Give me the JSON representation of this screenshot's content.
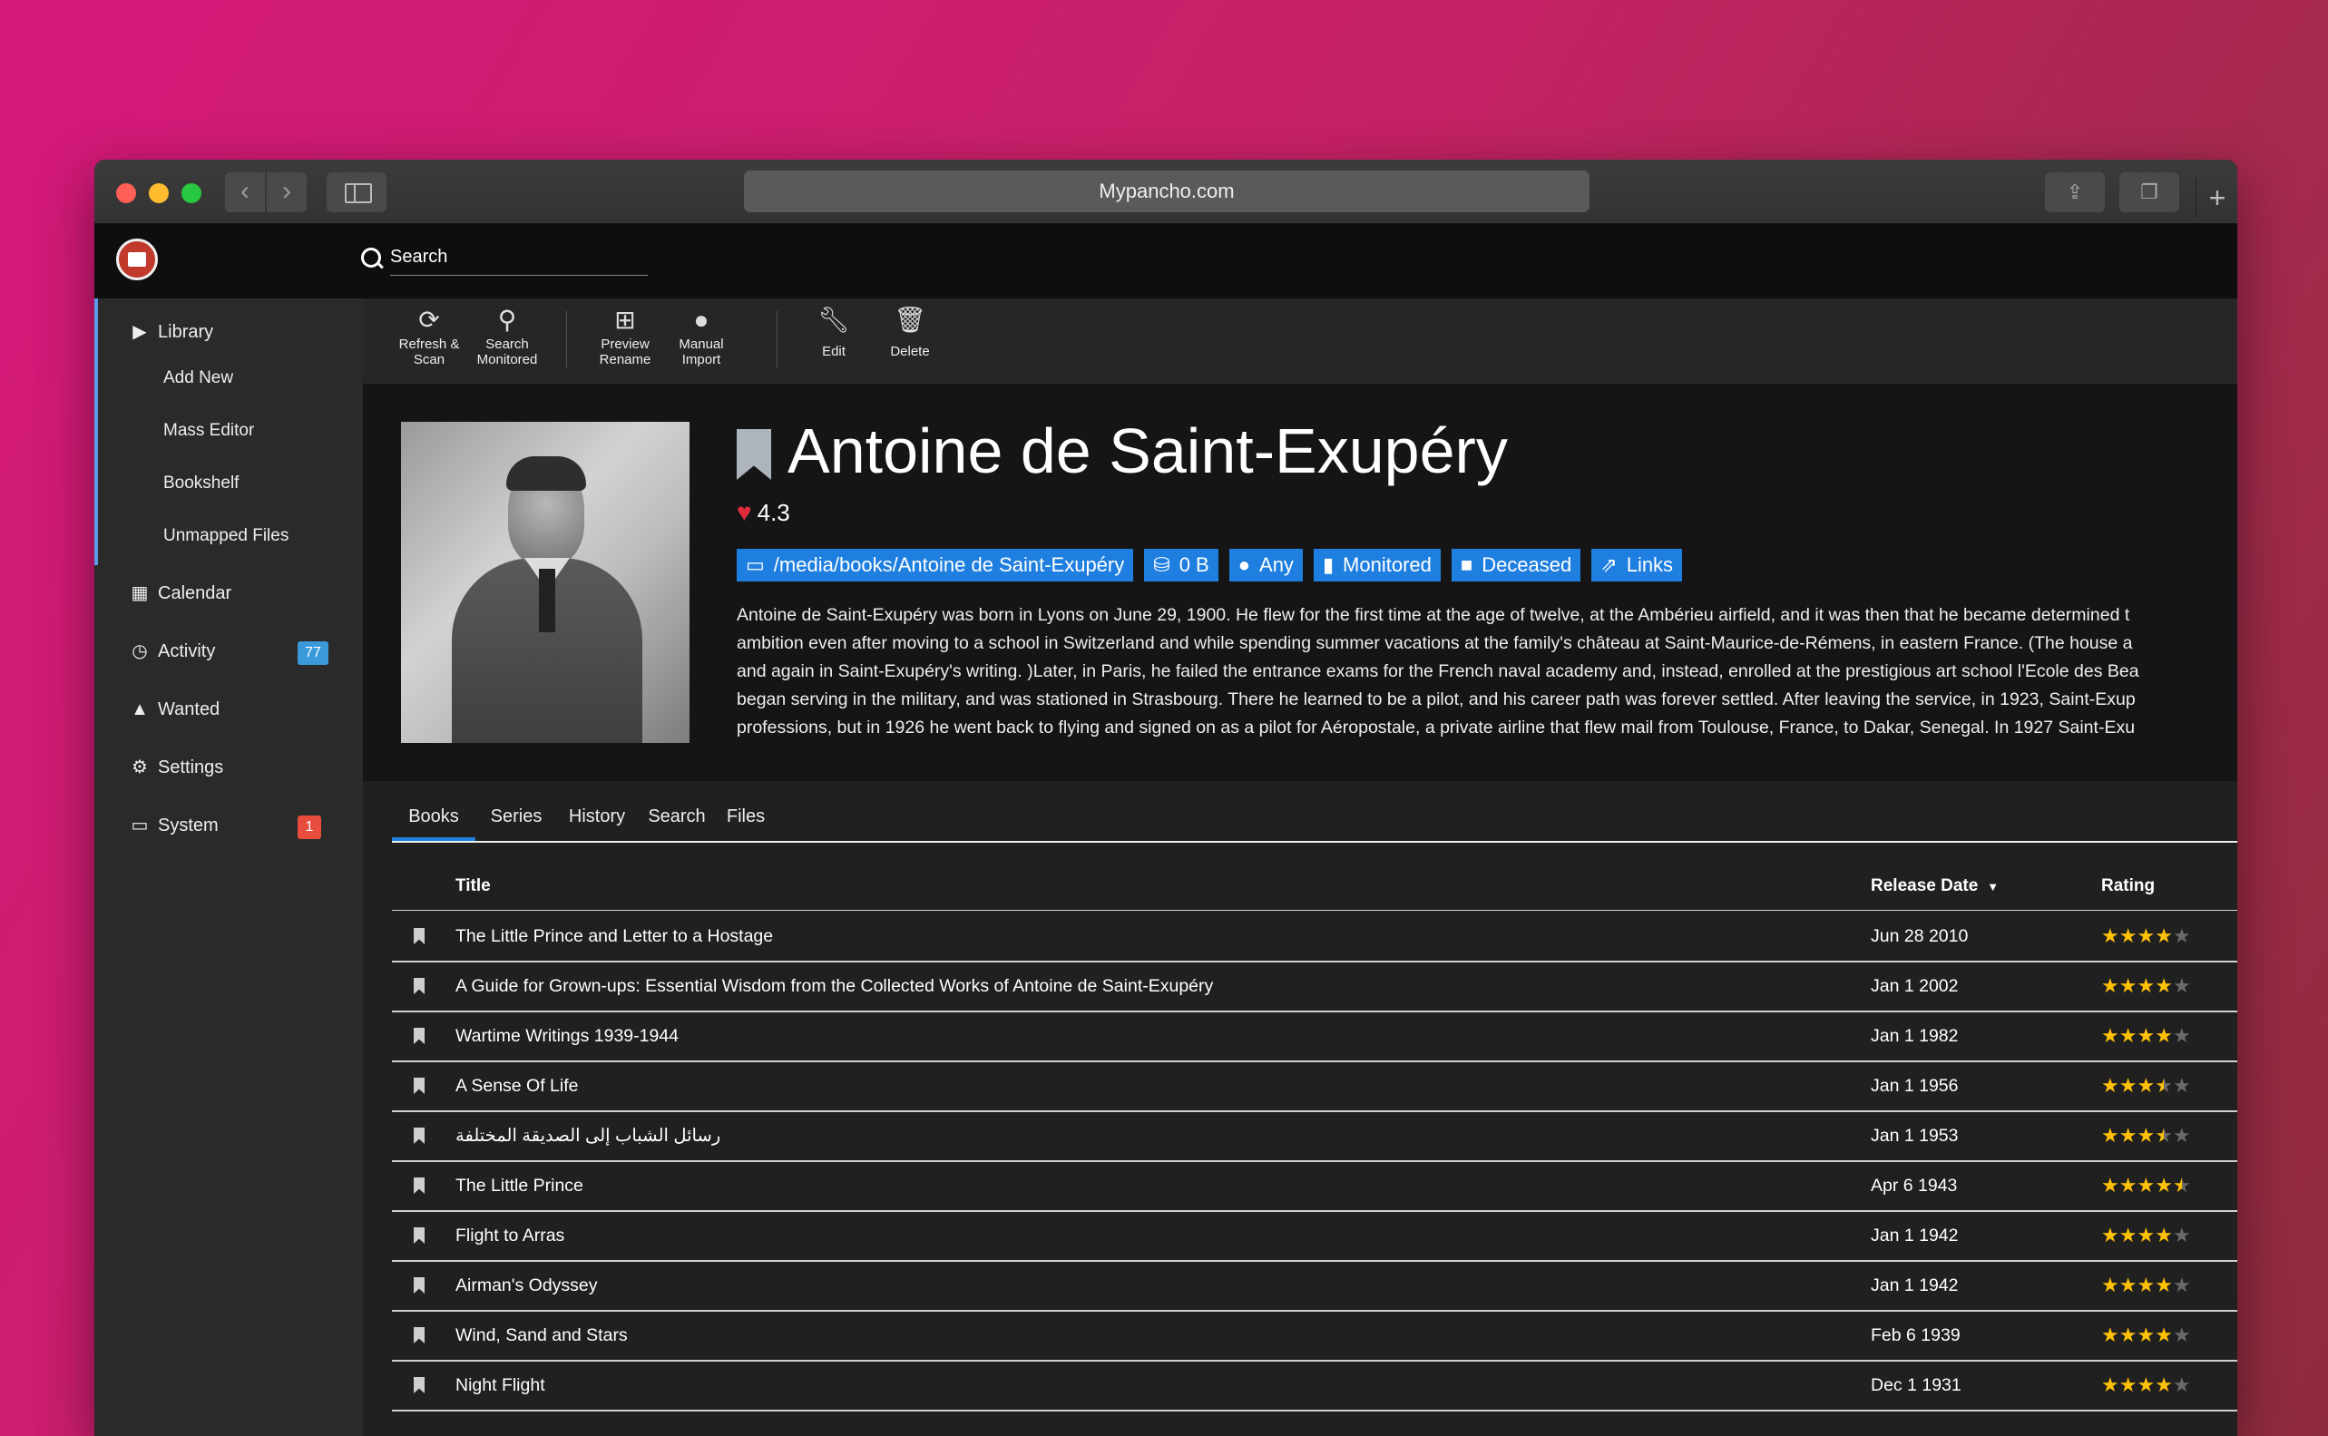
{
  "browser": {
    "url": "Mypancho.com"
  },
  "search": {
    "placeholder": "Search"
  },
  "sidebar": {
    "library": "Library",
    "sub_items": [
      "Add New",
      "Mass Editor",
      "Bookshelf",
      "Unmapped Files"
    ],
    "calendar": "Calendar",
    "activity": "Activity",
    "activity_badge": "77",
    "wanted": "Wanted",
    "settings": "Settings",
    "system": "System",
    "system_badge": "1"
  },
  "toolbar": {
    "refresh_line1": "Refresh &",
    "refresh_line2": "Scan",
    "search_line1": "Search",
    "search_line2": "Monitored",
    "preview_line1": "Preview",
    "preview_line2": "Rename",
    "manual_line1": "Manual",
    "manual_line2": "Import",
    "edit": "Edit",
    "delete": "Delete"
  },
  "author": {
    "name": "Antoine de Saint-Exupéry",
    "rating": "4.3",
    "labels": {
      "path": "/media/books/Antoine de Saint-Exupéry",
      "size": "0 B",
      "profile": "Any",
      "monitored": "Monitored",
      "status": "Deceased",
      "links": "Links"
    },
    "overview_lines": [
      "Antoine de Saint-Exupéry was born in Lyons on June 29, 1900. He flew for the first time at the age of twelve, at the Ambérieu airfield, and it was then that he became determined t",
      "ambition even after moving to a school in Switzerland and while spending summer vacations at the family's château at Saint-Maurice-de-Rémens, in eastern France. (The house a",
      "and again in Saint-Exupéry's writing. )Later, in Paris, he failed the entrance exams for the French naval academy and, instead, enrolled at the prestigious art school l'Ecole des Bea",
      "began serving in the military, and was stationed in Strasbourg. There he learned to be a pilot, and his career path was forever settled. After leaving the service, in 1923, Saint-Exup",
      "professions, but in 1926 he went back to flying and signed on as a pilot for Aéropostale, a private airline that flew mail from Toulouse, France, to Dakar, Senegal. In 1927 Saint-Exu"
    ]
  },
  "tabs": [
    "Books",
    "Series",
    "History",
    "Search",
    "Files"
  ],
  "table": {
    "headers": {
      "title": "Title",
      "release_date": "Release Date",
      "rating": "Rating"
    },
    "rows": [
      {
        "title": "The Little Prince and Letter to a Hostage",
        "date": "Jun 28 2010",
        "stars": 4
      },
      {
        "title": "A Guide for Grown-ups: Essential Wisdom from the Collected Works of Antoine de Saint-Exupéry",
        "date": "Jan 1 2002",
        "stars": 4
      },
      {
        "title": "Wartime Writings 1939-1944",
        "date": "Jan 1 1982",
        "stars": 4
      },
      {
        "title": "A Sense Of Life",
        "date": "Jan 1 1956",
        "stars": 3.5
      },
      {
        "title": "رسائل الشباب إلى الصديقة المختلفة",
        "date": "Jan 1 1953",
        "stars": 3.5
      },
      {
        "title": "The Little Prince",
        "date": "Apr 6 1943",
        "stars": 4.5
      },
      {
        "title": "Flight to Arras",
        "date": "Jan 1 1942",
        "stars": 4
      },
      {
        "title": "Airman's Odyssey",
        "date": "Jan 1 1942",
        "stars": 4
      },
      {
        "title": "Wind, Sand and Stars",
        "date": "Feb 6 1939",
        "stars": 4
      },
      {
        "title": "Night Flight",
        "date": "Dec 1 1931",
        "stars": 4
      }
    ]
  },
  "colors": {
    "accent": "#1f7fe0",
    "star": "#ffc107",
    "heart": "#e02b3d",
    "badge_blue": "#3a9ad9",
    "badge_red": "#e74c3c"
  }
}
